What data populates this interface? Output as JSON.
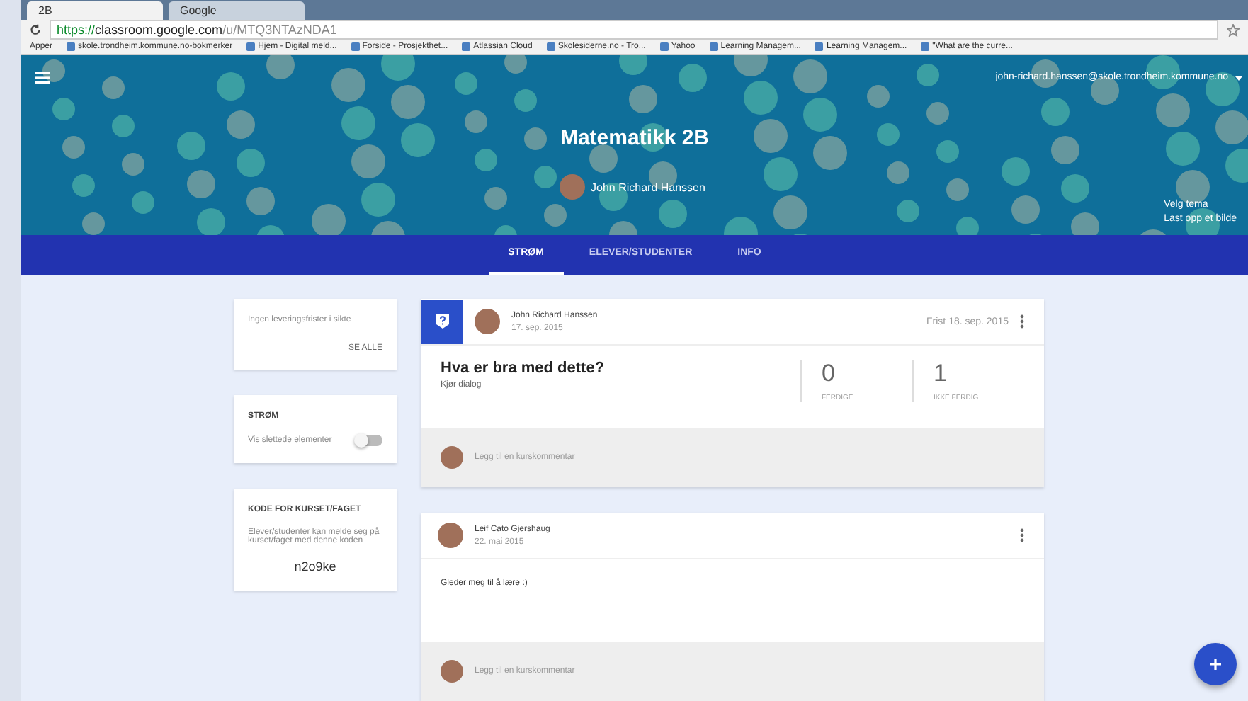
{
  "browser": {
    "tabs": [
      {
        "label": "2B",
        "selected": true
      },
      {
        "label": "Google",
        "selected": false
      }
    ],
    "url": {
      "secure": "https://",
      "host": "classroom.google.com",
      "path": "/u/MTQ3NTAzNDA1"
    },
    "bookmarks": [
      "Apper",
      "skole.trondheim.kommune.no-bokmerker",
      "Hjem - Digital meld...",
      "Forside - Prosjekthet...",
      "Atlassian Cloud",
      "Skolesiderne.no - Tro...",
      "Yahoo",
      "Learning Managem...",
      "Learning Managem...",
      "\"What are the curre..."
    ]
  },
  "header": {
    "account": "john-richard.hanssen@skole.trondheim.kommune.no",
    "title": "Matematikk 2B",
    "teacher": "John Richard Hanssen",
    "links": [
      "Velg tema",
      "Last opp et bilde"
    ]
  },
  "nav": [
    {
      "label": "STRØM",
      "selected": true
    },
    {
      "label": "ELEVER/STUDENTER",
      "selected": false
    },
    {
      "label": "INFO",
      "selected": false
    }
  ],
  "sidebar": {
    "upcoming": {
      "text": "Ingen leveringsfrister i sikte",
      "link": "SE ALLE"
    },
    "stream": {
      "title": "STRØM",
      "label": "Vis slettede elementer",
      "on": false
    },
    "code": {
      "title": "KODE FOR KURSET/FAGET",
      "text": "Elever/studenter kan melde seg på kurset/faget med denne koden",
      "code": "n2o9ke"
    }
  },
  "posts": [
    {
      "kind": "question",
      "author": "John Richard Hanssen",
      "date": "17. sep. 2015",
      "due": "Frist 18. sep. 2015",
      "title": "Hva er bra med dette?",
      "subtitle": "Kjør dialog",
      "stats": [
        {
          "value": "0",
          "label": "FERDIGE"
        },
        {
          "value": "1",
          "label": "IKKE FERDIG"
        }
      ],
      "comment": "Legg til en kurskommentar"
    },
    {
      "kind": "announcement",
      "author": "Leif Cato Gjershaug",
      "date": "22. mai 2015",
      "body": "Gleder meg til å lære :)",
      "comment": "Legg til en kurskommentar"
    }
  ]
}
